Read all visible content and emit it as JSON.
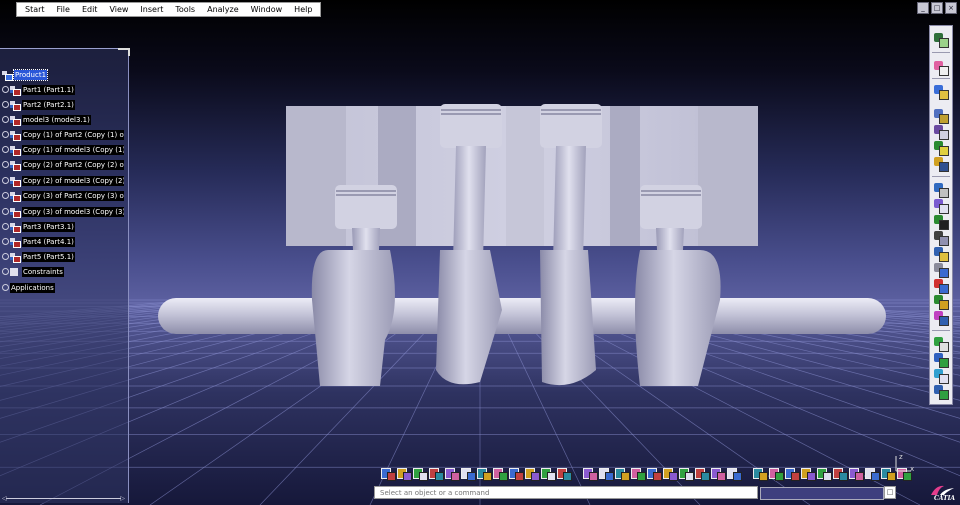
{
  "menubar": {
    "items": [
      "Start",
      "File",
      "Edit",
      "View",
      "Insert",
      "Tools",
      "Analyze",
      "Window",
      "Help"
    ]
  },
  "tree": {
    "root": "Product1",
    "nodes": [
      "Part1 (Part1.1)",
      "Part2 (Part2.1)",
      "model3 (model3.1)",
      "Copy (1) of Part2 (Copy (1) of Pa",
      "Copy (1) of model3 (Copy (1) of",
      "Copy (2) of Part2 (Copy (2) of Pa",
      "Copy (2) of model3 (Copy (2) of",
      "Copy (3) of Part2 (Copy (3) of Pa",
      "Copy (3) of model3 (Copy (3) of",
      "Part3 (Part3.1)",
      "Part4 (Part4.1)",
      "Part5 (Part5.1)",
      "Constraints"
    ],
    "applications": "Applications"
  },
  "status": {
    "placeholder": "Select an object or a command"
  },
  "logo": {
    "text": "CATIA"
  },
  "compass": {
    "z_label": "z",
    "x_label": "x"
  },
  "colors": {
    "tree_selected": "#2b57d8",
    "model": "#c8c8dc",
    "grid": "#8a8fd0"
  }
}
